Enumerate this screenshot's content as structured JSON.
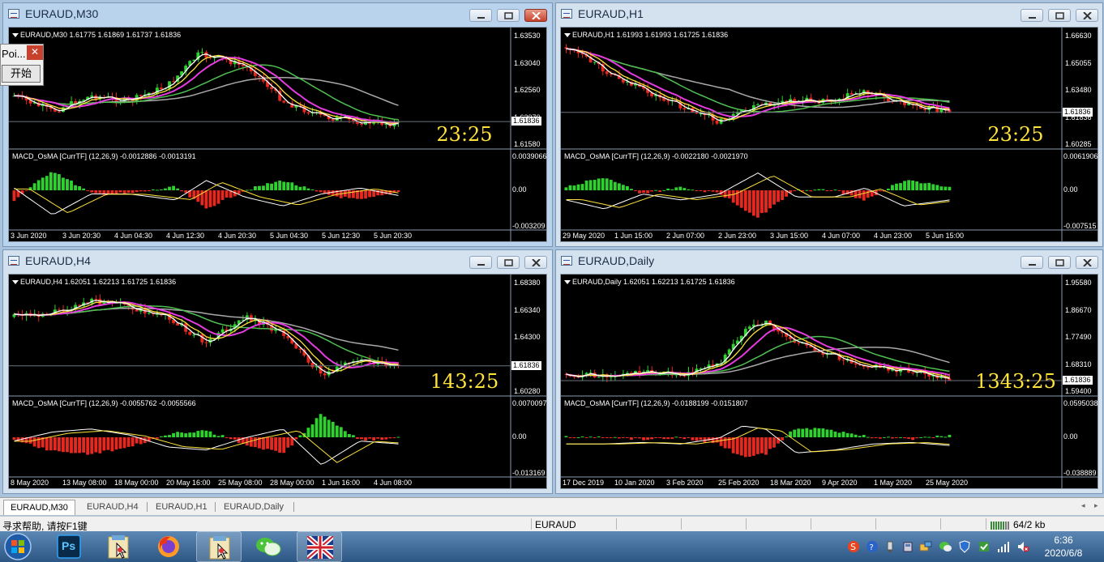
{
  "windows": [
    {
      "id": "m30",
      "title": "EURAUD,M30",
      "caption": "EURAUD,M30  1.61775 1.61869 1.61737 1.61836",
      "prices": [
        "1.63530",
        "1.63040",
        "1.62560",
        "1.62070",
        "1.61580"
      ],
      "current_price": "1.61836",
      "countdown": "23:25",
      "macd_caption": "MACD_OsMA [CurrTF] (12,26,9) -0.0012886 -0.0013191",
      "macd_levels": [
        "0.0039066",
        "0.00",
        "-0.003209"
      ],
      "time_labels": [
        "3 Jun 2020",
        "3 Jun 20:30",
        "4 Jun 04:30",
        "4 Jun 12:30",
        "4 Jun 20:30",
        "5 Jun 04:30",
        "5 Jun 12:30",
        "5 Jun 20:30"
      ]
    },
    {
      "id": "h1",
      "title": "EURAUD,H1",
      "caption": "EURAUD,H1  1.61993 1.61993 1.61725 1.61836",
      "prices": [
        "1.66630",
        "1.65055",
        "1.63480",
        "1.61836",
        "1.60285"
      ],
      "current_price": "1.61836",
      "countdown": "23:25",
      "macd_caption": "MACD_OsMA [CurrTF] (12,26,9) -0.0022180 -0.0021970",
      "macd_levels": [
        "0.0061906",
        "0.00",
        "-0.007515"
      ],
      "time_labels": [
        "29 May 2020",
        "1 Jun 15:00",
        "2 Jun 07:00",
        "2 Jun 23:00",
        "3 Jun 15:00",
        "4 Jun 07:00",
        "4 Jun 23:00",
        "5 Jun 15:00"
      ]
    },
    {
      "id": "h4",
      "title": "EURAUD,H4",
      "caption": "EURAUD,H4  1.62051 1.62213 1.61725 1.61836",
      "prices": [
        "1.68380",
        "1.66340",
        "1.64300",
        "1.62260",
        "1.60280"
      ],
      "current_price": "1.61836",
      "countdown": "143:25",
      "macd_caption": "MACD_OsMA [CurrTF] (12,26,9) -0.0055762 -0.0055566",
      "macd_levels": [
        "0.0070097",
        "0.00",
        "-0.013169"
      ],
      "time_labels": [
        "8 May 2020",
        "13 May 08:00",
        "18 May 00:00",
        "20 May 16:00",
        "25 May 08:00",
        "28 May 00:00",
        "1 Jun 16:00",
        "4 Jun 08:00"
      ]
    },
    {
      "id": "d1",
      "title": "EURAUD,Daily",
      "caption": "EURAUD,Daily  1.62051 1.62213 1.61725 1.61836",
      "prices": [
        "1.95580",
        "1.86670",
        "1.77490",
        "1.68310",
        "1.59400"
      ],
      "current_price": "1.61836",
      "countdown": "1343:25",
      "macd_caption": "MACD_OsMA [CurrTF] (12,26,9) -0.0188199 -0.0151807",
      "macd_levels": [
        "0.0595038",
        "0.00",
        "-0.038889"
      ],
      "time_labels": [
        "17 Dec 2019",
        "10 Jan 2020",
        "3 Feb 2020",
        "25 Feb 2020",
        "18 Mar 2020",
        "9 Apr 2020",
        "1 May 2020",
        "25 May 2020"
      ]
    }
  ],
  "popup": {
    "title": "Poi...",
    "close": "✕",
    "button": "开始"
  },
  "tabs": [
    "EURAUD,M30",
    "EURAUD,H4",
    "EURAUD,H1",
    "EURAUD,Daily"
  ],
  "status": {
    "help": "寻求帮助, 请按F1键",
    "symbol": "EURAUD",
    "traffic": "64/2 kb"
  },
  "taskbar": {
    "apps": [
      "start-orb-icon",
      "photoshop-icon",
      "chart-app-icon",
      "firefox-icon",
      "chart-app-icon",
      "wechat-icon",
      "flag-app-icon"
    ],
    "ps_label": "Ps",
    "time": "6:36",
    "date": "2020/6/8"
  },
  "colors": {
    "bull": "#2fd12f",
    "bear": "#e8281e",
    "ma_fast": "#ffffff",
    "ma_yellow": "#ffe23a",
    "ma_magenta": "#e53be0",
    "ma_green": "#4fc04f",
    "ma_gray": "#a9a9a9",
    "countdown": "#ffe23a"
  }
}
